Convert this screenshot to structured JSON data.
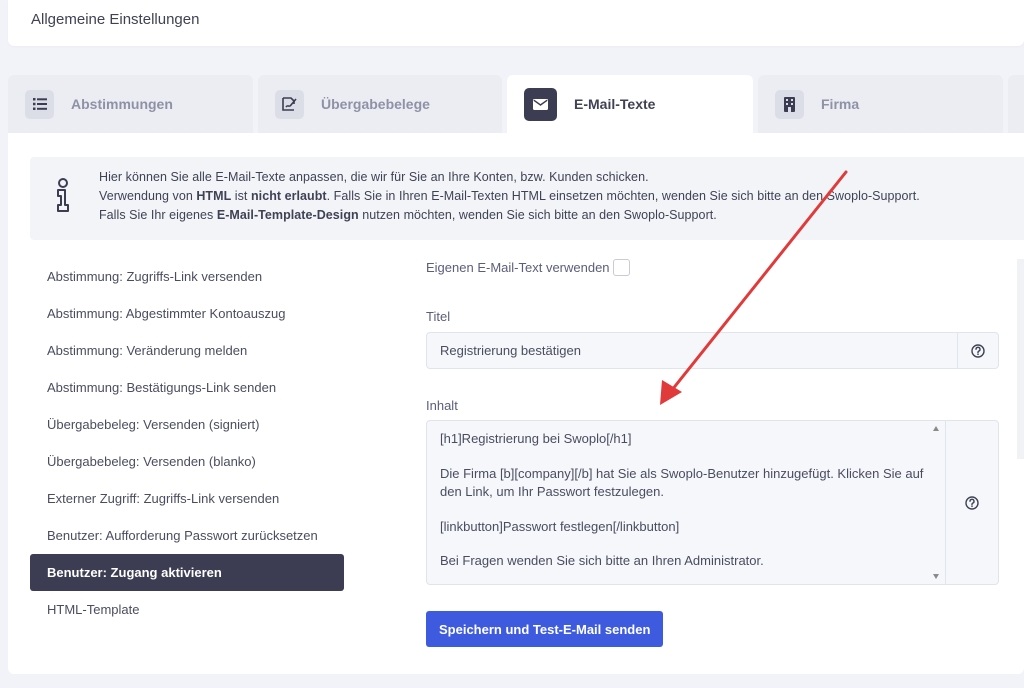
{
  "header": {
    "title": "Allgemeine Einstellungen"
  },
  "tabs": [
    {
      "label": "Abstimmungen",
      "icon": "list-icon"
    },
    {
      "label": "Übergabebelege",
      "icon": "signature-icon"
    },
    {
      "label": "E-Mail-Texte",
      "icon": "envelope-icon",
      "active": true
    },
    {
      "label": "Firma",
      "icon": "building-icon"
    }
  ],
  "notice": {
    "line1": "Hier können Sie alle E-Mail-Texte anpassen, die wir für Sie an Ihre Konten, bzw. Kunden schicken.",
    "line2_a": "Verwendung von ",
    "line2_b": "HTML",
    "line2_c": " ist ",
    "line2_d": "nicht erlaubt",
    "line2_e": ". Falls Sie in Ihren E-Mail-Texten HTML einsetzen möchten, wenden Sie sich bitte an den Swoplo-Support.",
    "line3_a": "Falls Sie Ihr eigenes ",
    "line3_b": "E-Mail-Template-Design",
    "line3_c": " nutzen möchten, wenden Sie sich bitte an den Swoplo-Support."
  },
  "menu": [
    "Abstimmung: Zugriffs-Link versenden",
    "Abstimmung: Abgestimmter Kontoauszug",
    "Abstimmung: Veränderung melden",
    "Abstimmung: Bestätigungs-Link senden",
    "Übergabebeleg: Versenden (signiert)",
    "Übergabebeleg: Versenden (blanko)",
    "Externer Zugriff: Zugriffs-Link versenden",
    "Benutzer: Aufforderung Passwort zurücksetzen",
    "Benutzer: Zugang aktivieren",
    "HTML-Template"
  ],
  "menu_active_index": 8,
  "form": {
    "own_text_label": "Eigenen E-Mail-Text verwenden",
    "own_text_checked": false,
    "title_label": "Titel",
    "title_value": "Registrierung bestätigen",
    "content_label": "Inhalt",
    "content_paragraphs": [
      "[h1]Registrierung bei Swoplo[/h1]",
      "Die Firma [b][company][/b] hat Sie als Swoplo-Benutzer hinzugefügt. Klicken Sie auf den Link, um Ihr Passwort festzulegen.",
      "[linkbutton]Passwort festlegen[/linkbutton]",
      "Bei Fragen wenden Sie sich bitte an Ihren Administrator."
    ],
    "submit_label": "Speichern und Test-E-Mail senden"
  },
  "colors": {
    "accent": "#3e5be0",
    "dark": "#3c3d52",
    "arrow": "#e03a3a"
  }
}
